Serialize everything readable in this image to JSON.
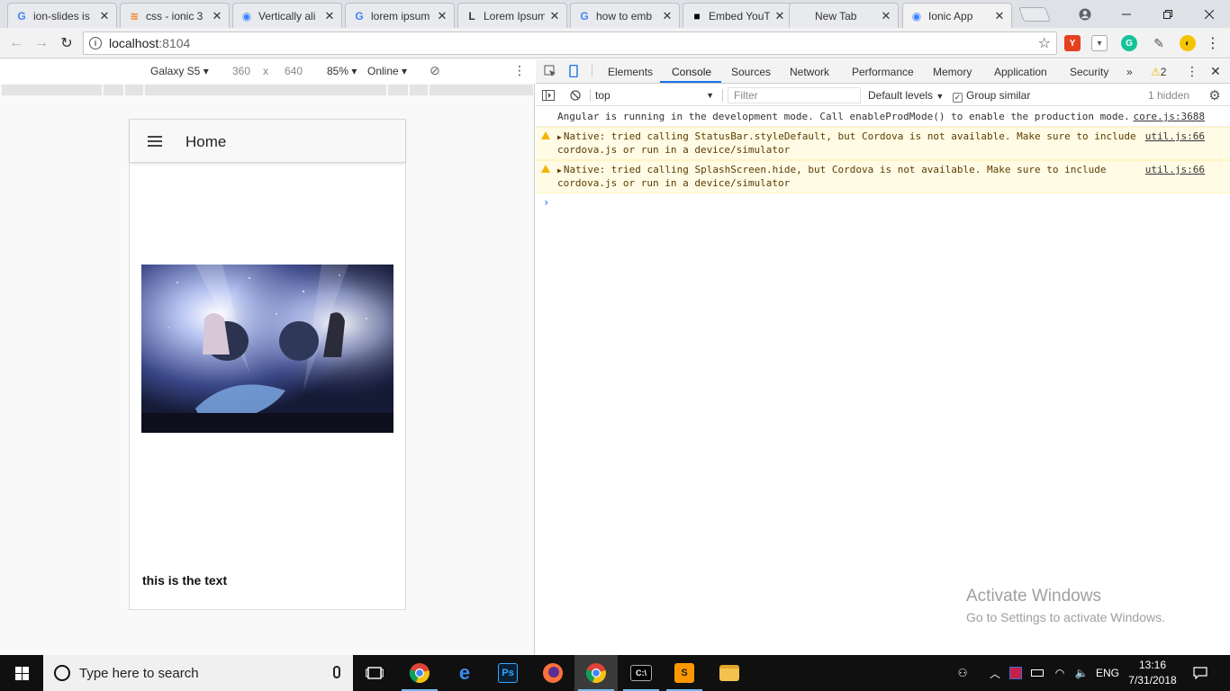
{
  "browser": {
    "tabs": [
      {
        "title": "ion-slides is",
        "favicon": "google-icon",
        "fav_text": "G",
        "fav_color": "#4285f4"
      },
      {
        "title": "css - ionic 3",
        "favicon": "stackoverflow-icon",
        "fav_text": "≋",
        "fav_color": "#f48024"
      },
      {
        "title": "Vertically ali",
        "favicon": "ionic-icon",
        "fav_text": "◉",
        "fav_color": "#3880ff"
      },
      {
        "title": "lorem ipsum",
        "favicon": "google-icon",
        "fav_text": "G",
        "fav_color": "#4285f4"
      },
      {
        "title": "Lorem Ipsum",
        "favicon": "lorem-ipsum-icon",
        "fav_text": "L",
        "fav_color": "#333333"
      },
      {
        "title": "how to emb",
        "favicon": "google-icon",
        "fav_text": "G",
        "fav_color": "#4285f4"
      },
      {
        "title": "Embed YouT",
        "favicon": "embed-icon",
        "fav_text": "■",
        "fav_color": "#000000"
      },
      {
        "title": "New Tab",
        "favicon": "",
        "fav_text": "",
        "fav_color": "#333333"
      },
      {
        "title": "Ionic App",
        "favicon": "ionic-icon",
        "fav_text": "◉",
        "fav_color": "#3880ff"
      }
    ],
    "url_host": "localhost",
    "url_port": ":8104"
  },
  "device": {
    "model": "Galaxy S5",
    "width": "360",
    "times": "x",
    "height": "640",
    "zoom": "85%",
    "network": "Online"
  },
  "app": {
    "title": "Home",
    "text": "this is the text"
  },
  "devtools": {
    "tabs": [
      "Elements",
      "Console",
      "Sources",
      "Network",
      "Performance",
      "Memory",
      "Application",
      "Security"
    ],
    "more": "»",
    "warning_count": "2",
    "context": "top",
    "filter_placeholder": "Filter",
    "levels": "Default levels",
    "group_similar": "Group similar",
    "hidden": "1 hidden",
    "messages": [
      {
        "type": "info",
        "text": "Angular is running in the development mode. Call enableProdMode() to enable the production mode.",
        "source": "core.js:3688"
      },
      {
        "type": "warn",
        "text": "Native: tried calling StatusBar.styleDefault, but Cordova is not available. Make sure to include cordova.js or run in a device/simulator",
        "source": "util.js:66"
      },
      {
        "type": "warn",
        "text": "Native: tried calling SplashScreen.hide, but Cordova is not available. Make sure to include cordova.js or run in a device/simulator",
        "source": "util.js:66"
      }
    ],
    "prompt": "›"
  },
  "watermark": {
    "line1": "Activate Windows",
    "line2": "Go to Settings to activate Windows."
  },
  "taskbar": {
    "search_placeholder": "Type here to search",
    "language": "ENG",
    "time": "13:16",
    "date": "7/31/2018"
  },
  "colors": {
    "accent": "#1a73e8",
    "warning_bg": "#fffbe5",
    "taskbar": "#101010"
  }
}
